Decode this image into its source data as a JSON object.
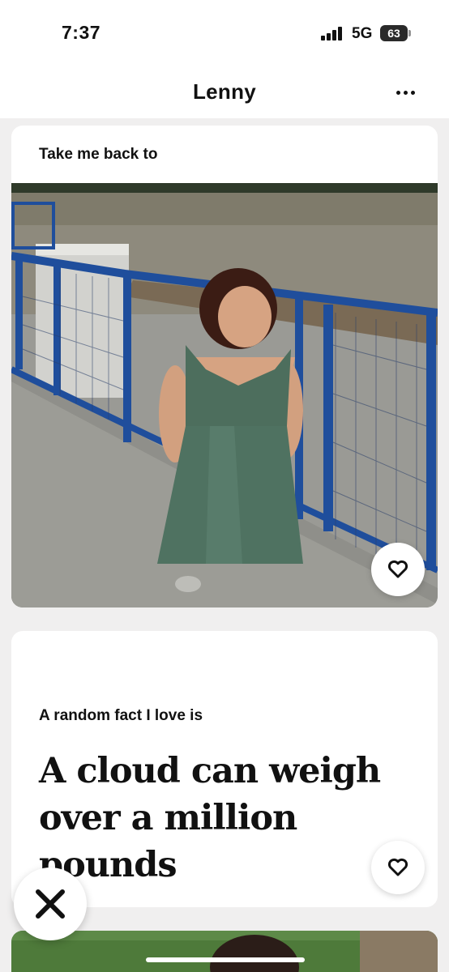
{
  "status_bar": {
    "time": "7:37",
    "network": "5G",
    "battery": "63",
    "icons": [
      "signal-icon",
      "battery-icon"
    ]
  },
  "header": {
    "name": "Lenny",
    "more_icon": "more-horizontal-icon"
  },
  "prompts": [
    {
      "type": "photo",
      "label": "Take me back to",
      "like_icon": "heart-icon"
    },
    {
      "type": "text",
      "label": "A random fact I love is",
      "answer": "A cloud can weigh over a million pounds",
      "like_icon": "heart-icon"
    }
  ],
  "actions": {
    "dislike_icon": "close-x-icon"
  },
  "colors": {
    "background": "#f0efef",
    "card": "#ffffff",
    "text": "#111111",
    "railing": "#1f4e9c",
    "dress": "#4d6e5d"
  }
}
